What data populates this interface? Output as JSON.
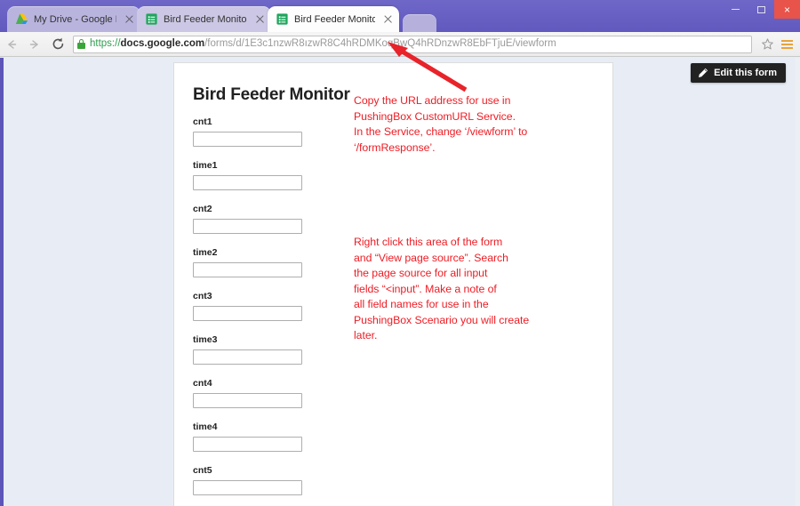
{
  "window": {
    "minimize_label": "–",
    "maximize_label": "□",
    "close_label": "×"
  },
  "tabs": [
    {
      "title": "My Drive - Google Drive",
      "favicon": "google-drive-icon",
      "active": false
    },
    {
      "title": "Bird Feeder Monitor - Goo",
      "favicon": "google-forms-icon",
      "active": false
    },
    {
      "title": "Bird Feeder Monitor",
      "favicon": "google-forms-icon",
      "active": true
    }
  ],
  "toolbar": {
    "back_icon": "back-arrow-icon",
    "forward_icon": "forward-arrow-icon",
    "reload_icon": "reload-icon",
    "lock_icon": "secure-lock-icon",
    "bookmark_icon": "star-icon",
    "menu_icon": "hamburger-menu-icon",
    "url": {
      "scheme": "https://",
      "host": "docs.google.com",
      "path": "/forms/d/1E3c1nzwR8ızwR8C4hRDMKoqBwQ4hRDnzwR8EbFTjuE/viewform",
      "full": "https://docs.google.com/forms/d/1E3c1nzwR8ızwR8C4hRDMKoqBwQ4hRDnzwR8EbFTjuE/viewform"
    }
  },
  "form": {
    "title": "Bird Feeder Monitor",
    "edit_button_label": "Edit this form",
    "edit_button_icon": "pencil-icon",
    "fields": [
      {
        "label": "cnt1",
        "value": "",
        "placeholder": ""
      },
      {
        "label": "time1",
        "value": "",
        "placeholder": ""
      },
      {
        "label": "cnt2",
        "value": "",
        "placeholder": ""
      },
      {
        "label": "time2",
        "value": "",
        "placeholder": ""
      },
      {
        "label": "cnt3",
        "value": "",
        "placeholder": ""
      },
      {
        "label": "time3",
        "value": "",
        "placeholder": ""
      },
      {
        "label": "cnt4",
        "value": "",
        "placeholder": ""
      },
      {
        "label": "time4",
        "value": "",
        "placeholder": ""
      },
      {
        "label": "cnt5",
        "value": "",
        "placeholder": ""
      }
    ]
  },
  "annotations": {
    "color": "#ee1c24",
    "url_note": "Copy the URL address for use in\nPushingBox CustomURL Service.\nIn the Service, change ‘/viewform’ to\n‘/formResponse’.",
    "source_note": "Right click this area of the form\nand “View page source”.  Search\nthe page source for all input\nfields “<input”.  Make a note of\nall field names for use in the\nPushingBox Scenario you will create\nlater.",
    "arrow_icon": "red-arrow-pointing-to-url"
  },
  "colors": {
    "titlebar": "#6b63c4",
    "page_background": "#e8edf5",
    "annotation_red": "#ee1c24",
    "lock_green": "#3aa53a",
    "menu_orange": "#e8a33d",
    "close_button": "#e8534a",
    "forms_green": "#1ea65c"
  }
}
